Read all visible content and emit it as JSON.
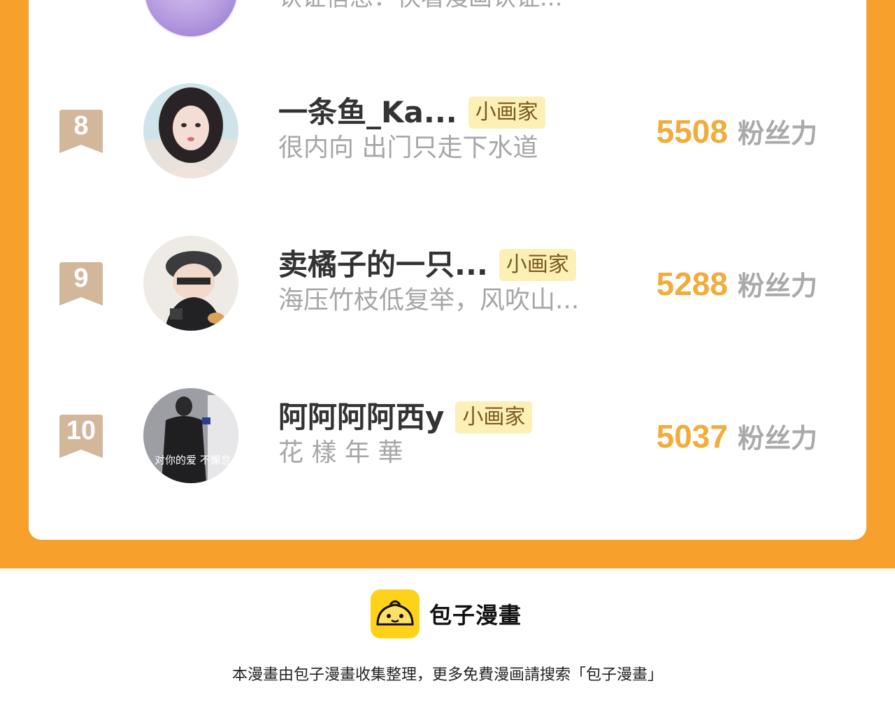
{
  "previous_row": {
    "description": "认证信息：快看漫画认证..."
  },
  "rankings": [
    {
      "rank": "8",
      "name": "一条鱼_Ka...",
      "badge": "小画家",
      "description": "很内向 出门只走下水道",
      "fans_value": "5508",
      "fans_label": "粉丝力"
    },
    {
      "rank": "9",
      "name": "卖橘子的一只...",
      "badge": "小画家",
      "description": "海压竹枝低复举，风吹山...",
      "fans_value": "5288",
      "fans_label": "粉丝力"
    },
    {
      "rank": "10",
      "name": "阿阿阿阿西y",
      "badge": "小画家",
      "description": "花 樣 年 華",
      "fans_value": "5037",
      "fans_label": "粉丝力",
      "avatar_caption": "对你的爱 不懈怠"
    }
  ],
  "footer": {
    "brand": "包子漫畫",
    "note": "本漫畫由包子漫畫收集整理，更多免費漫画請搜索「包子漫畫」"
  },
  "colors": {
    "background_orange": "#f7a02b",
    "fans_number": "#f1ac3a",
    "rank_ribbon": "#d3b79a",
    "badge_bg": "#fdf0b7",
    "logo_yellow": "#ffd21a"
  }
}
